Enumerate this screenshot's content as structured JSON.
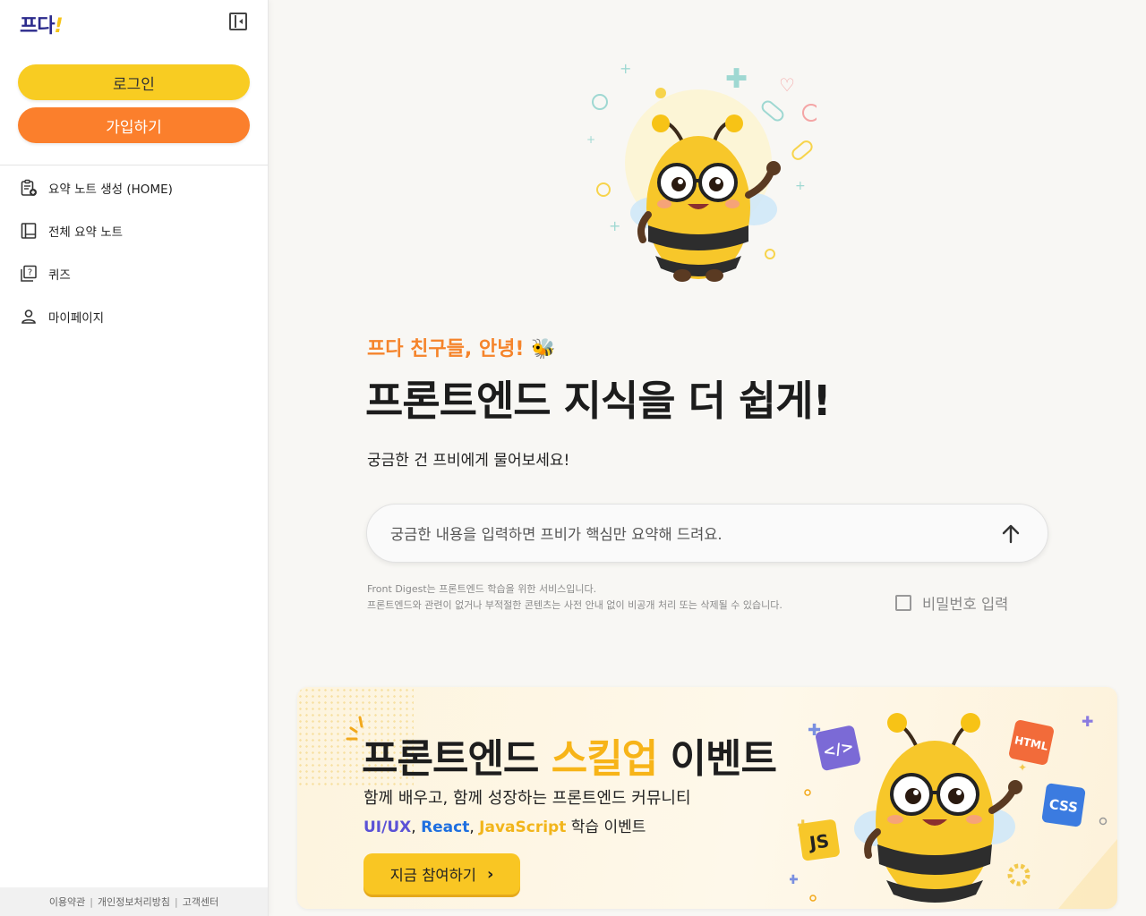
{
  "sidebar": {
    "logo_main": "프다",
    "logo_bang": "!",
    "login_label": "로그인",
    "signup_label": "가입하기",
    "nav": [
      {
        "label": "요약 노트 생성 (HOME)",
        "icon": "note-add-icon"
      },
      {
        "label": "전체 요약 노트",
        "icon": "book-icon"
      },
      {
        "label": "퀴즈",
        "icon": "quiz-icon"
      },
      {
        "label": "마이페이지",
        "icon": "user-icon"
      }
    ],
    "footer": {
      "terms": "이용약관",
      "privacy": "개인정보처리방침",
      "support": "고객센터",
      "separator": "|"
    }
  },
  "main": {
    "greeting": "프다 친구들, 안녕! 🐝",
    "headline": "프론트엔드 지식을 더 쉽게!",
    "subtext": "궁금한 건 프비에게 물어보세요!",
    "search": {
      "placeholder": "궁금한 내용을 입력하면 프비가 핵심만 요약해 드려요.",
      "value": ""
    },
    "notice_line1": "Front Digest는 프론트엔드 학습을 위한 서비스입니다.",
    "notice_line2": "프론트엔드와 관련이 없거나 부적절한 콘텐츠는 사전 안내 없이 비공개 처리 또는 삭제될 수 있습니다.",
    "password_label": "비밀번호 입력"
  },
  "banner": {
    "title_part1": "프론트엔드 ",
    "title_highlight": "스킬업",
    "title_part2": " 이벤트",
    "subtitle": "함께 배우고, 함께 성장하는 프론트엔드 커뮤니티",
    "tag1": "UI/UX",
    "tag2": "React",
    "tag3": "JavaScript",
    "tag_suffix": " 학습 이벤트",
    "comma": ", ",
    "button_label": "지금 참여하기",
    "badges": {
      "code": "</>",
      "html": "HTML",
      "css": "CSS",
      "js": "JS"
    }
  },
  "colors": {
    "accent_yellow": "#f8cc22",
    "accent_orange": "#fb7f2c",
    "logo_navy": "#2b2a8c",
    "greeting_orange": "#f5842b"
  }
}
